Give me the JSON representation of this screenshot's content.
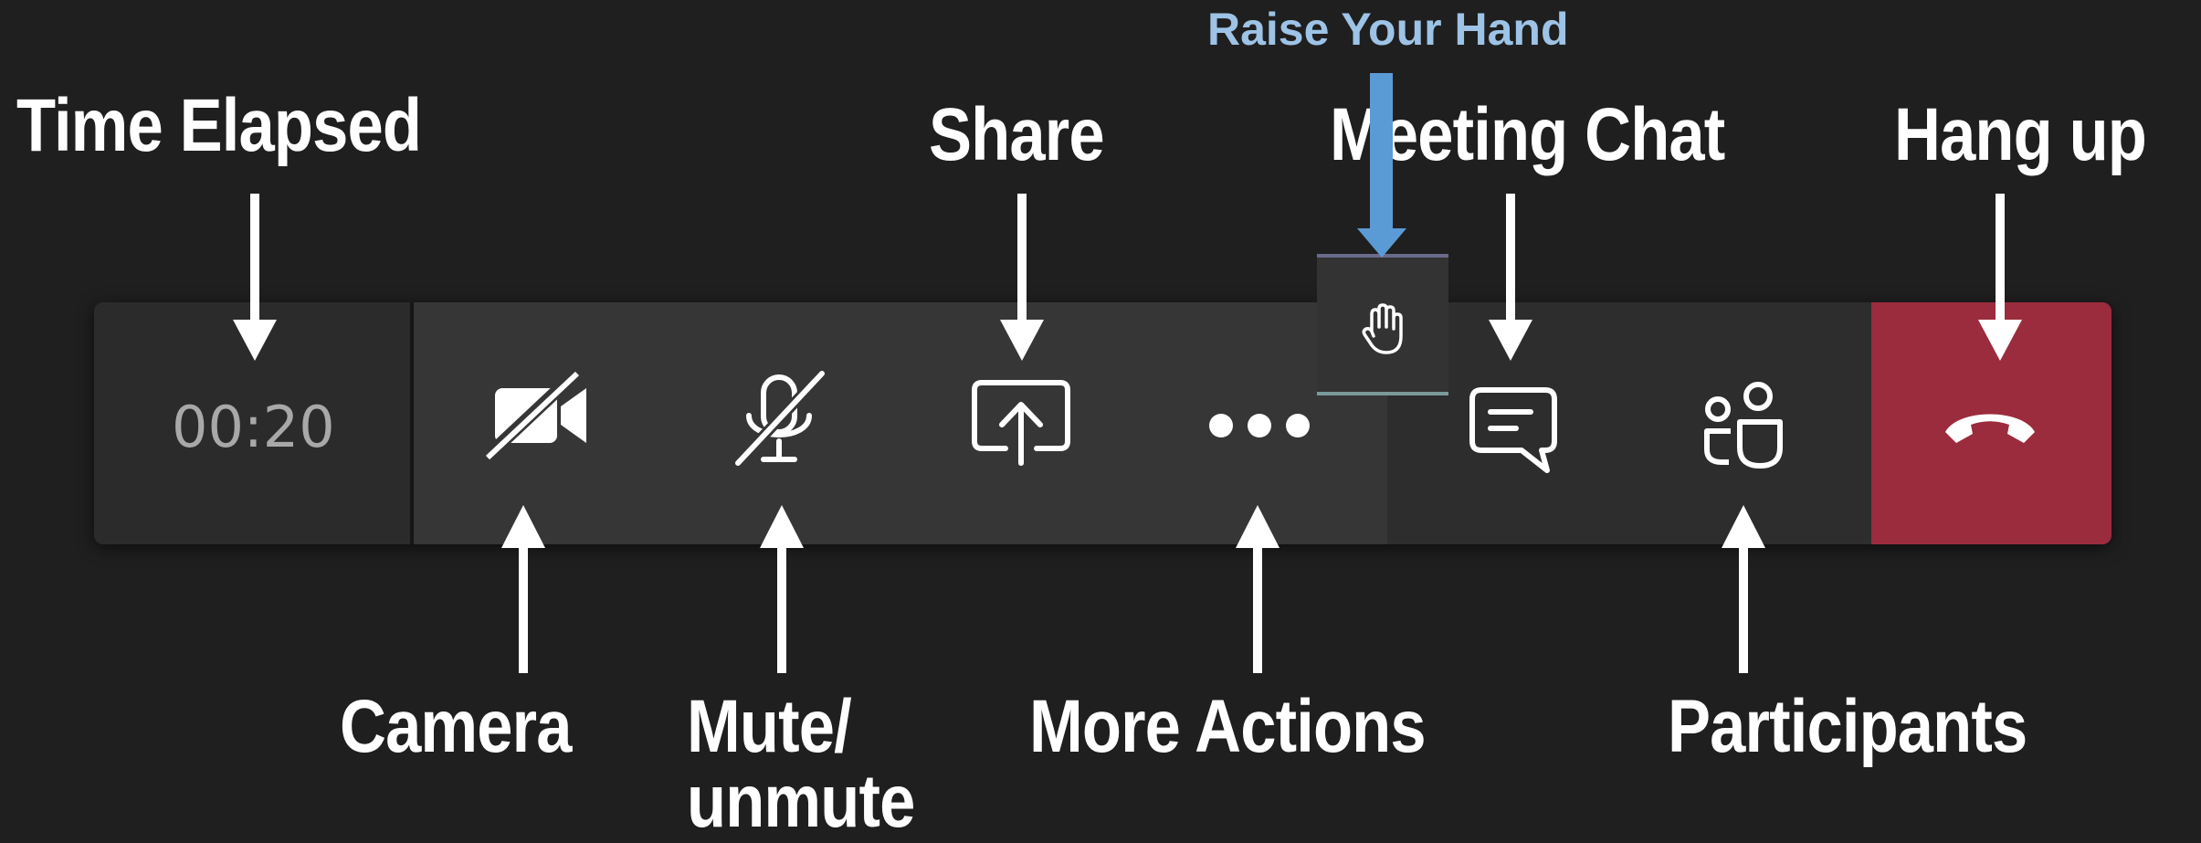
{
  "annotations": {
    "time_elapsed": "Time Elapsed",
    "share": "Share",
    "raise_hand": "Raise Your Hand",
    "meeting_chat": "Meeting Chat",
    "hang_up": "Hang up",
    "camera": "Camera",
    "mute_unmute": "Mute/\nunmute",
    "more_actions": "More Actions",
    "participants": "Participants"
  },
  "toolbar": {
    "timer": "00:20",
    "buttons": {
      "camera": "camera-off-icon",
      "mic": "mic-off-icon",
      "share": "share-screen-icon",
      "more": "more-dots-icon",
      "raise_hand": "hand-icon",
      "chat": "chat-icon",
      "participants": "participants-icon",
      "hangup": "phone-hangup-icon"
    }
  },
  "colors": {
    "background": "#1f1f1f",
    "toolbar": "#363636",
    "hangup": "#9b2c3d",
    "raise_hand_label": "#9dc3e6",
    "raise_hand_arrow": "#5b9bd5"
  }
}
